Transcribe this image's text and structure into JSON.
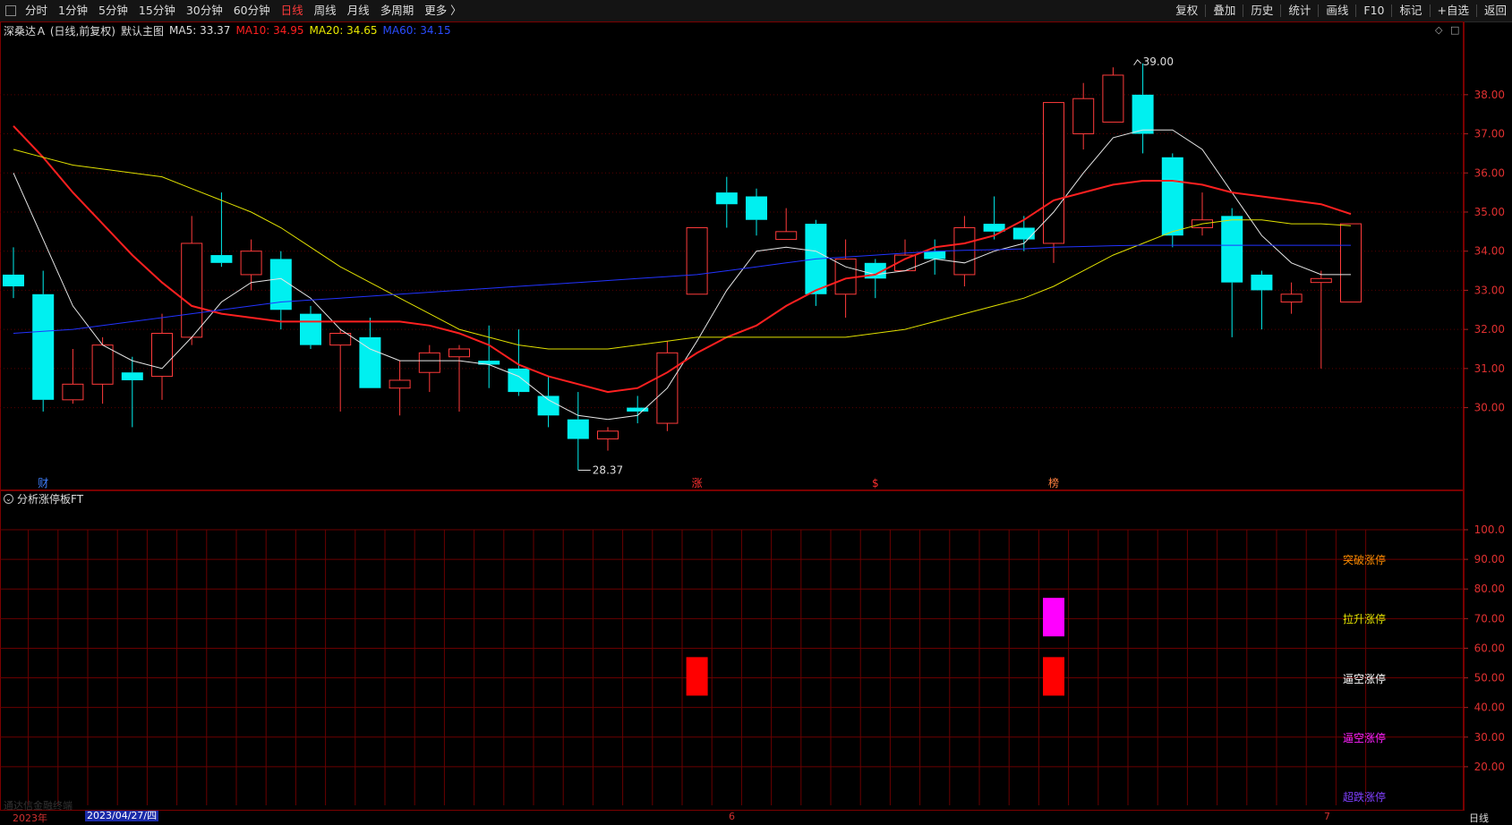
{
  "toolbar": {
    "periods": [
      "分时",
      "1分钟",
      "5分钟",
      "15分钟",
      "30分钟",
      "60分钟",
      "日线",
      "周线",
      "月线",
      "多周期",
      "更多 〉"
    ],
    "active_period": "日线",
    "actions": [
      "复权",
      "叠加",
      "历史",
      "统计",
      "画线",
      "F10",
      "标记",
      "+自选",
      "返回"
    ]
  },
  "info": {
    "stock": "深桑达Ａ (日线,前复权)",
    "main_plot": "默认主图",
    "ma5": "MA5: 33.37",
    "ma10": "MA10: 34.95",
    "ma20": "MA20: 34.65",
    "ma60": "MA60: 34.15"
  },
  "chart_ctrl": {
    "diamond": "◇",
    "box": "□"
  },
  "colors": {
    "up": "#ff3b3b",
    "down": "#00f0f0",
    "ma5": "#e6e6e6",
    "ma10": "#ff2020",
    "ma20": "#e0e000",
    "ma60": "#2233ff",
    "grid": "#5a0000"
  },
  "chart_data": [
    {
      "type": "candlestick",
      "ylim": [
        28.0,
        39.3
      ],
      "y_ticks": [
        "38.00",
        "37.00",
        "36.00",
        "35.00",
        "34.00",
        "33.00",
        "32.00",
        "31.00",
        "30.00"
      ],
      "high_label": "39.00",
      "low_label": "28.37",
      "event_markers": [
        {
          "index": 1,
          "text": "财",
          "color": "#4080ff"
        },
        {
          "index": 23,
          "text": "涨",
          "color": "#ff3030"
        },
        {
          "index": 29,
          "text": "$",
          "color": "#ff3030"
        },
        {
          "index": 35,
          "text": "榜",
          "color": "#ff8040"
        }
      ],
      "candles": [
        {
          "o": 33.4,
          "c": 33.1,
          "h": 34.1,
          "l": 32.8
        },
        {
          "o": 32.9,
          "c": 30.2,
          "h": 33.5,
          "l": 29.9
        },
        {
          "o": 30.2,
          "c": 30.6,
          "h": 31.5,
          "l": 30.1
        },
        {
          "o": 30.6,
          "c": 31.6,
          "h": 31.8,
          "l": 30.1
        },
        {
          "o": 30.9,
          "c": 30.7,
          "h": 31.3,
          "l": 29.5
        },
        {
          "o": 30.8,
          "c": 31.9,
          "h": 32.4,
          "l": 30.2
        },
        {
          "o": 31.8,
          "c": 34.2,
          "h": 34.9,
          "l": 31.6
        },
        {
          "o": 33.9,
          "c": 33.7,
          "h": 35.5,
          "l": 33.6
        },
        {
          "o": 33.4,
          "c": 34.0,
          "h": 34.3,
          "l": 33.0
        },
        {
          "o": 33.8,
          "c": 32.5,
          "h": 34.0,
          "l": 32.0
        },
        {
          "o": 32.4,
          "c": 31.6,
          "h": 32.6,
          "l": 31.5
        },
        {
          "o": 31.6,
          "c": 31.9,
          "h": 32.0,
          "l": 29.9
        },
        {
          "o": 31.8,
          "c": 30.5,
          "h": 32.3,
          "l": 30.5
        },
        {
          "o": 30.5,
          "c": 30.7,
          "h": 31.2,
          "l": 29.8
        },
        {
          "o": 30.9,
          "c": 31.4,
          "h": 31.6,
          "l": 30.4
        },
        {
          "o": 31.3,
          "c": 31.5,
          "h": 31.6,
          "l": 29.9
        },
        {
          "o": 31.2,
          "c": 31.1,
          "h": 32.1,
          "l": 30.5
        },
        {
          "o": 31.0,
          "c": 30.4,
          "h": 32.0,
          "l": 30.3
        },
        {
          "o": 30.3,
          "c": 29.8,
          "h": 30.8,
          "l": 29.5
        },
        {
          "o": 29.7,
          "c": 29.2,
          "h": 30.4,
          "l": 28.4
        },
        {
          "o": 29.2,
          "c": 29.4,
          "h": 29.5,
          "l": 28.9
        },
        {
          "o": 30.0,
          "c": 29.9,
          "h": 30.3,
          "l": 29.6
        },
        {
          "o": 29.6,
          "c": 31.4,
          "h": 31.7,
          "l": 29.4
        },
        {
          "o": 32.9,
          "c": 34.6,
          "h": 34.6,
          "l": 32.9
        },
        {
          "o": 35.5,
          "c": 35.2,
          "h": 35.9,
          "l": 34.6
        },
        {
          "o": 35.4,
          "c": 34.8,
          "h": 35.6,
          "l": 34.4
        },
        {
          "o": 34.3,
          "c": 34.5,
          "h": 35.1,
          "l": 34.3
        },
        {
          "o": 34.7,
          "c": 32.9,
          "h": 34.8,
          "l": 32.6
        },
        {
          "o": 32.9,
          "c": 33.8,
          "h": 34.3,
          "l": 32.3
        },
        {
          "o": 33.7,
          "c": 33.3,
          "h": 33.8,
          "l": 32.8
        },
        {
          "o": 33.5,
          "c": 33.9,
          "h": 34.3,
          "l": 33.5
        },
        {
          "o": 34.0,
          "c": 33.8,
          "h": 34.3,
          "l": 33.4
        },
        {
          "o": 33.4,
          "c": 34.6,
          "h": 34.9,
          "l": 33.1
        },
        {
          "o": 34.7,
          "c": 34.5,
          "h": 35.4,
          "l": 34.3
        },
        {
          "o": 34.6,
          "c": 34.3,
          "h": 34.9,
          "l": 34.0
        },
        {
          "o": 34.2,
          "c": 37.8,
          "h": 37.8,
          "l": 33.7
        },
        {
          "o": 37.0,
          "c": 37.9,
          "h": 38.3,
          "l": 36.6
        },
        {
          "o": 37.3,
          "c": 38.5,
          "h": 38.7,
          "l": 37.3
        },
        {
          "o": 38.0,
          "c": 37.0,
          "h": 38.8,
          "l": 36.5
        },
        {
          "o": 36.4,
          "c": 34.4,
          "h": 36.5,
          "l": 34.1
        },
        {
          "o": 34.6,
          "c": 34.8,
          "h": 35.5,
          "l": 34.4
        },
        {
          "o": 34.9,
          "c": 33.2,
          "h": 35.1,
          "l": 31.8
        },
        {
          "o": 33.4,
          "c": 33.0,
          "h": 33.5,
          "l": 32.0
        },
        {
          "o": 32.7,
          "c": 32.9,
          "h": 33.2,
          "l": 32.4
        },
        {
          "o": 33.2,
          "c": 33.3,
          "h": 33.5,
          "l": 31.0
        },
        {
          "o": 32.7,
          "c": 34.7,
          "h": 34.7,
          "l": 32.7
        }
      ],
      "ma_lines": [
        {
          "name": "MA5",
          "values": [
            36.0,
            34.3,
            32.6,
            31.6,
            31.2,
            31.0,
            31.8,
            32.7,
            33.2,
            33.3,
            32.8,
            32.0,
            31.5,
            31.2,
            31.2,
            31.2,
            31.1,
            30.8,
            30.2,
            29.8,
            29.7,
            29.8,
            30.5,
            31.7,
            33.0,
            34.0,
            34.1,
            34.0,
            33.6,
            33.4,
            33.5,
            33.8,
            33.7,
            34.0,
            34.2,
            35.0,
            36.0,
            36.9,
            37.1,
            37.1,
            36.6,
            35.5,
            34.4,
            33.7,
            33.4,
            33.4
          ]
        },
        {
          "name": "MA10",
          "values": [
            37.2,
            36.4,
            35.5,
            34.7,
            33.9,
            33.2,
            32.6,
            32.4,
            32.3,
            32.2,
            32.2,
            32.2,
            32.2,
            32.2,
            32.1,
            31.9,
            31.6,
            31.1,
            30.8,
            30.6,
            30.4,
            30.5,
            30.9,
            31.4,
            31.8,
            32.1,
            32.6,
            33.0,
            33.3,
            33.4,
            33.8,
            34.1,
            34.2,
            34.4,
            34.8,
            35.3,
            35.5,
            35.7,
            35.8,
            35.8,
            35.7,
            35.5,
            35.4,
            35.3,
            35.2,
            34.95
          ]
        },
        {
          "name": "MA20",
          "values": [
            36.6,
            36.4,
            36.2,
            36.1,
            36.0,
            35.9,
            35.6,
            35.3,
            35.0,
            34.6,
            34.1,
            33.6,
            33.2,
            32.8,
            32.4,
            32.0,
            31.8,
            31.6,
            31.5,
            31.5,
            31.5,
            31.6,
            31.7,
            31.8,
            31.8,
            31.8,
            31.8,
            31.8,
            31.8,
            31.9,
            32.0,
            32.2,
            32.4,
            32.6,
            32.8,
            33.1,
            33.5,
            33.9,
            34.2,
            34.5,
            34.7,
            34.8,
            34.8,
            34.7,
            34.7,
            34.65
          ]
        },
        {
          "name": "MA60",
          "values": [
            31.9,
            31.95,
            32.0,
            32.1,
            32.2,
            32.3,
            32.4,
            32.5,
            32.6,
            32.7,
            32.75,
            32.8,
            32.85,
            32.9,
            32.95,
            33.0,
            33.05,
            33.1,
            33.15,
            33.2,
            33.25,
            33.3,
            33.35,
            33.4,
            33.5,
            33.6,
            33.7,
            33.8,
            33.85,
            33.9,
            33.95,
            34.0,
            34.02,
            34.04,
            34.06,
            34.1,
            34.12,
            34.14,
            34.15,
            34.15,
            34.15,
            34.15,
            34.15,
            34.15,
            34.15,
            34.15
          ]
        }
      ]
    },
    {
      "type": "bar",
      "title": "分析涨停板FT",
      "ylim": [
        10,
        100
      ],
      "y_ticks": [
        "100.0",
        "90.00",
        "80.00",
        "70.00",
        "60.00",
        "50.00",
        "40.00",
        "30.00",
        "20.00"
      ],
      "legend": [
        {
          "text": "突破涨停",
          "color": "#ff8c00",
          "level": 90
        },
        {
          "text": "拉升涨停",
          "color": "#e0e000",
          "level": 70
        },
        {
          "text": "逼空涨停",
          "color": "#ffffff",
          "level": 50
        },
        {
          "text": "逼空涨停",
          "color": "#ff20ff",
          "level": 30
        },
        {
          "text": "超跌涨停",
          "color": "#8040ff",
          "level": 10
        }
      ],
      "bars": [
        {
          "index": 23,
          "low": 44,
          "high": 57,
          "color": "#ff0000"
        },
        {
          "index": 35,
          "low": 44,
          "high": 57,
          "color": "#ff0000"
        },
        {
          "index": 35,
          "low": 64,
          "high": 77,
          "color": "#ff00ff"
        }
      ]
    }
  ],
  "bottom": {
    "year": "2023年",
    "selected_date": "2023/04/27/四",
    "month_marks": [
      "6",
      "7"
    ],
    "period": "日线"
  },
  "watermark": "通达信金融终端"
}
